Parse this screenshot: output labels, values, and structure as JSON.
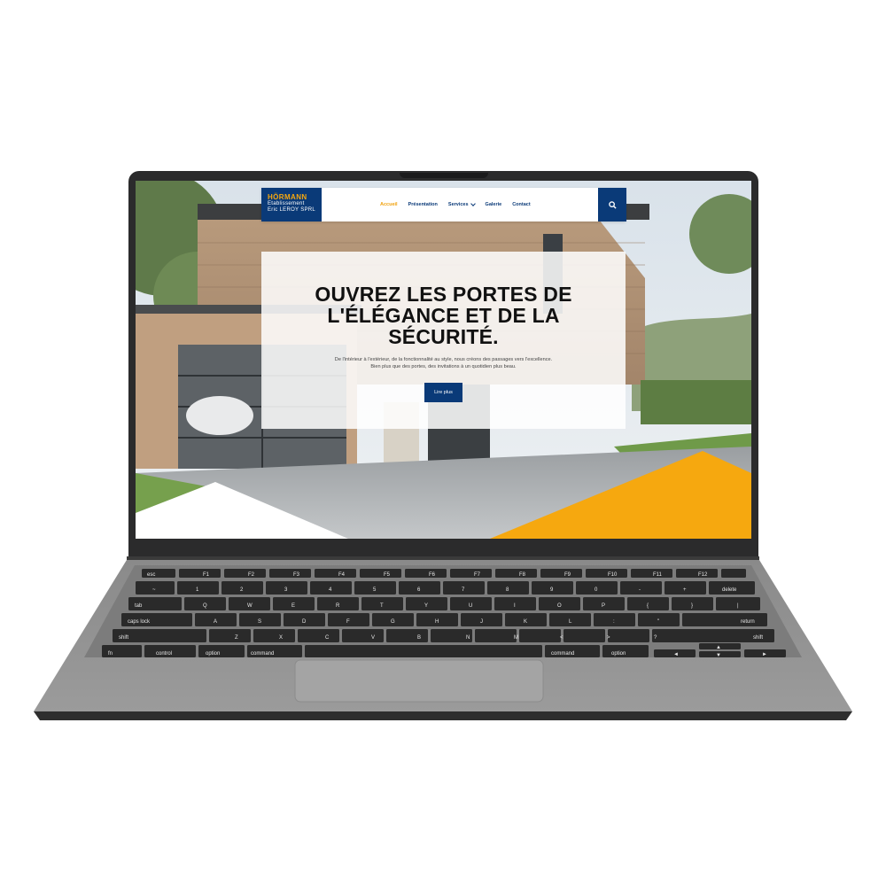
{
  "site": {
    "logo": {
      "brand": "HÖRMANN",
      "line1": "Etablissement",
      "line2": "Eric LEROY SPRL"
    },
    "nav": [
      {
        "label": "Accueil",
        "active": true
      },
      {
        "label": "Présentation"
      },
      {
        "label": "Services",
        "has_dropdown": true
      },
      {
        "label": "Galerie"
      },
      {
        "label": "Contact"
      }
    ],
    "search_icon": "search-icon",
    "hero": {
      "title": "OUVREZ LES PORTES DE L'ÉLÉGANCE ET DE LA SÉCURITÉ.",
      "text_line1": "De l'intérieur à l'extérieur, de la fonctionnalité au style, nous créons des passages vers l'excellence.",
      "text_line2": "Bien plus que des portes, des invitations à un quotidien plus beau.",
      "button": "Lire plus"
    },
    "colors": {
      "brand_blue": "#0a3a78",
      "accent_orange": "#f6a80f"
    }
  },
  "keyboard": {
    "row_fn": [
      "esc",
      "F1",
      "F2",
      "F3",
      "F4",
      "F5",
      "F6",
      "F7",
      "F8",
      "F9",
      "F10",
      "F11",
      "F12"
    ],
    "row_num": [
      "~",
      "1",
      "2",
      "3",
      "4",
      "5",
      "6",
      "7",
      "8",
      "9",
      "0",
      "-",
      "+",
      "delete"
    ],
    "row_q": [
      "tab",
      "Q",
      "W",
      "E",
      "R",
      "T",
      "Y",
      "U",
      "I",
      "O",
      "P",
      "{",
      "}",
      "|"
    ],
    "row_a": [
      "caps lock",
      "A",
      "S",
      "D",
      "F",
      "G",
      "H",
      "J",
      "K",
      "L",
      ":",
      "\"",
      "return"
    ],
    "row_z": [
      "shift",
      "Z",
      "X",
      "C",
      "V",
      "B",
      "N",
      "M",
      "<",
      ">",
      "?",
      "shift"
    ],
    "row_bottom": [
      "fn",
      "control",
      "option",
      "command",
      "command",
      "option"
    ],
    "arrows": [
      "◄",
      "▲",
      "▼",
      "►"
    ]
  }
}
